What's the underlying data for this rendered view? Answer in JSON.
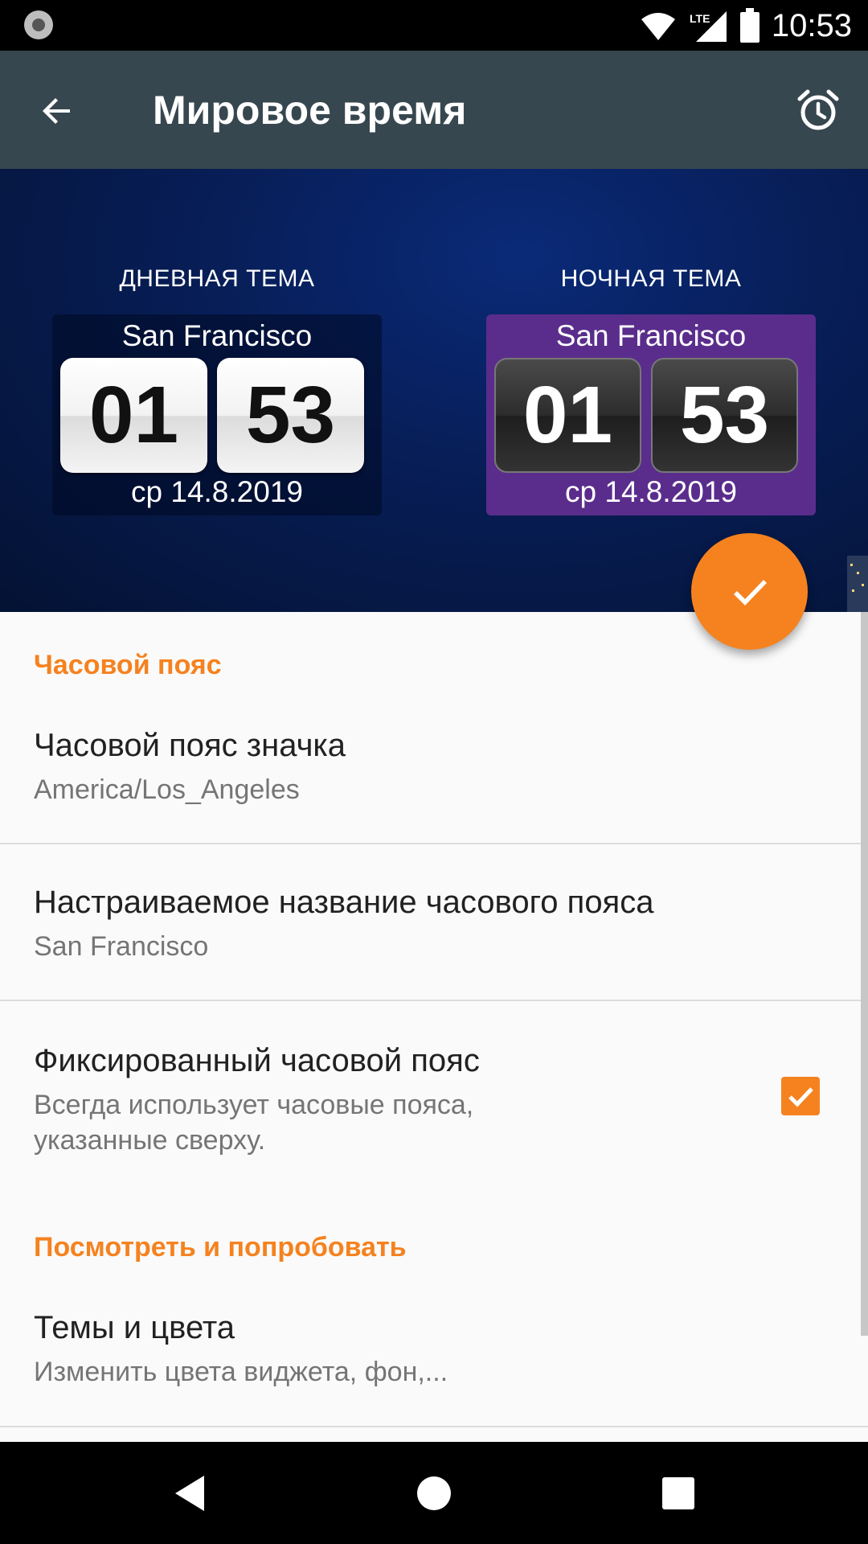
{
  "status_bar": {
    "time": "10:53",
    "network": "LTE"
  },
  "toolbar": {
    "title": "Мировое время"
  },
  "themes": {
    "day": {
      "label": "ДНЕВНАЯ ТЕМА",
      "city": "San Francisco",
      "hours": "01",
      "minutes": "53",
      "date": "ср 14.8.2019"
    },
    "night": {
      "label": "НОЧНАЯ ТЕМА",
      "city": "San Francisco",
      "hours": "01",
      "minutes": "53",
      "date": "ср 14.8.2019"
    }
  },
  "sections": {
    "timezone": {
      "header": "Часовой пояс"
    },
    "look": {
      "header": "Посмотреть и попробовать"
    }
  },
  "prefs": {
    "icon_timezone": {
      "title": "Часовой пояс значка",
      "summary": "America/Los_Angeles"
    },
    "custom_name": {
      "title": "Настраиваемое название часового пояса",
      "summary": "San Francisco"
    },
    "fixed_timezone": {
      "title": "Фиксированный часовой пояс",
      "summary": "Всегда использует часовые пояса, указанные сверху.",
      "checked": true
    },
    "themes_colors": {
      "title": "Темы и цвета",
      "summary": "Изменить цвета виджета, фон,..."
    }
  },
  "colors": {
    "accent": "#f5821f",
    "toolbar": "#37474f",
    "night_widget": "#5a2d8c"
  }
}
